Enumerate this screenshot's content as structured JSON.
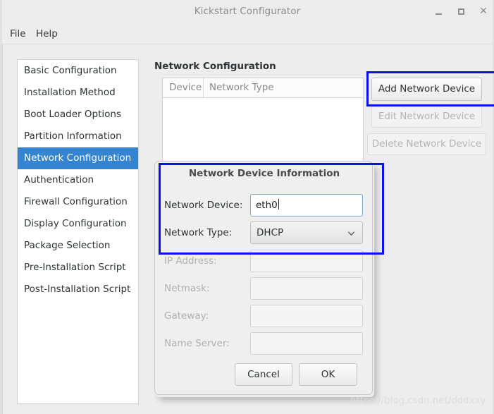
{
  "window": {
    "title": "Kickstart Configurator",
    "controls": {
      "minimize": "minimize-icon",
      "maximize": "maximize-icon",
      "close": "close-icon"
    }
  },
  "menubar": {
    "items": [
      {
        "label": "File"
      },
      {
        "label": "Help"
      }
    ]
  },
  "sidebar": {
    "items": [
      {
        "label": "Basic Configuration",
        "selected": false
      },
      {
        "label": "Installation Method",
        "selected": false
      },
      {
        "label": "Boot Loader Options",
        "selected": false
      },
      {
        "label": "Partition Information",
        "selected": false
      },
      {
        "label": "Network Configuration",
        "selected": true
      },
      {
        "label": "Authentication",
        "selected": false
      },
      {
        "label": "Firewall Configuration",
        "selected": false
      },
      {
        "label": "Display Configuration",
        "selected": false
      },
      {
        "label": "Package Selection",
        "selected": false
      },
      {
        "label": "Pre-Installation Script",
        "selected": false
      },
      {
        "label": "Post-Installation Script",
        "selected": false
      }
    ]
  },
  "main": {
    "title": "Network Configuration",
    "table": {
      "columns": [
        "Device",
        "Network Type"
      ],
      "rows": []
    },
    "buttons": {
      "add": "Add Network Device",
      "edit": "Edit Network Device",
      "delete": "Delete Network Device"
    }
  },
  "dialog": {
    "title": "Network Device Information",
    "fields": [
      {
        "label": "Network Device:",
        "value": "eth0",
        "kind": "text",
        "enabled": true
      },
      {
        "label": "Network Type:",
        "value": "DHCP",
        "kind": "select",
        "enabled": true
      },
      {
        "label": "IP Address:",
        "value": "",
        "kind": "text",
        "enabled": false
      },
      {
        "label": "Netmask:",
        "value": "",
        "kind": "text",
        "enabled": false
      },
      {
        "label": "Gateway:",
        "value": "",
        "kind": "text",
        "enabled": false
      },
      {
        "label": "Name Server:",
        "value": "",
        "kind": "text",
        "enabled": false
      }
    ],
    "buttons": {
      "cancel": "Cancel",
      "ok": "OK"
    },
    "dropdown_icon": "chevron-down-icon"
  },
  "annotations": {
    "accent_color": "#0a12e8",
    "boxes": [
      {
        "name": "add-network-device-highlight"
      },
      {
        "name": "network-device-information-highlight"
      }
    ]
  },
  "watermark": {
    "text": "https://blog.csdn.net/dddxxy"
  },
  "colors": {
    "selection": "#3584cf",
    "window_bg": "#ededed",
    "dialog_bg": "#efefef",
    "text": "#2e3436",
    "disabled_text": "#b0b0b0"
  }
}
